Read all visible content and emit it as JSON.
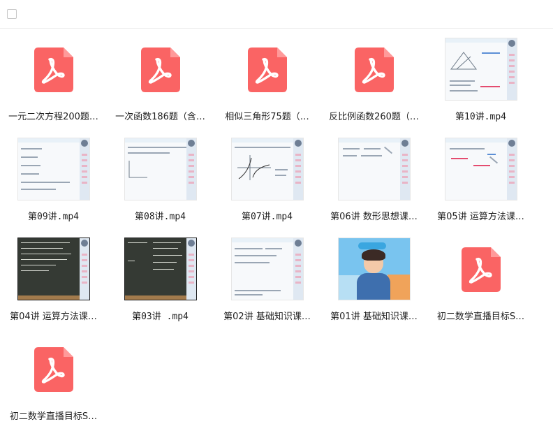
{
  "toolbar": {
    "select_all_label": ""
  },
  "files": [
    {
      "name": "一元二次方程200题…",
      "type": "pdf"
    },
    {
      "name": "一次函数186题（含…",
      "type": "pdf"
    },
    {
      "name": "相似三角形75题（…",
      "type": "pdf"
    },
    {
      "name": "反比例函数260题（…",
      "type": "pdf"
    },
    {
      "name": "第10讲.mp4",
      "type": "video"
    },
    {
      "name": "第09讲.mp4",
      "type": "video"
    },
    {
      "name": "第08讲.mp4",
      "type": "video"
    },
    {
      "name": "第07讲.mp4",
      "type": "video"
    },
    {
      "name": "第06讲 数形思想课…",
      "type": "video"
    },
    {
      "name": "第05讲 运算方法课…",
      "type": "video"
    },
    {
      "name": "第04讲 运算方法课…",
      "type": "video"
    },
    {
      "name": "第03讲 .mp4",
      "type": "video"
    },
    {
      "name": "第02讲 基础知识课…",
      "type": "video"
    },
    {
      "name": "第01讲 基础知识课…",
      "type": "video"
    },
    {
      "name": "初二数学直播目标S…",
      "type": "pdf"
    },
    {
      "name": "初二数学直播目标S…",
      "type": "pdf"
    }
  ],
  "colors": {
    "pdf_red": "#fa6464",
    "pdf_fold": "#ff9a9a"
  },
  "icons": {
    "pdf": "pdf-file-icon",
    "video": "video-thumbnail"
  }
}
